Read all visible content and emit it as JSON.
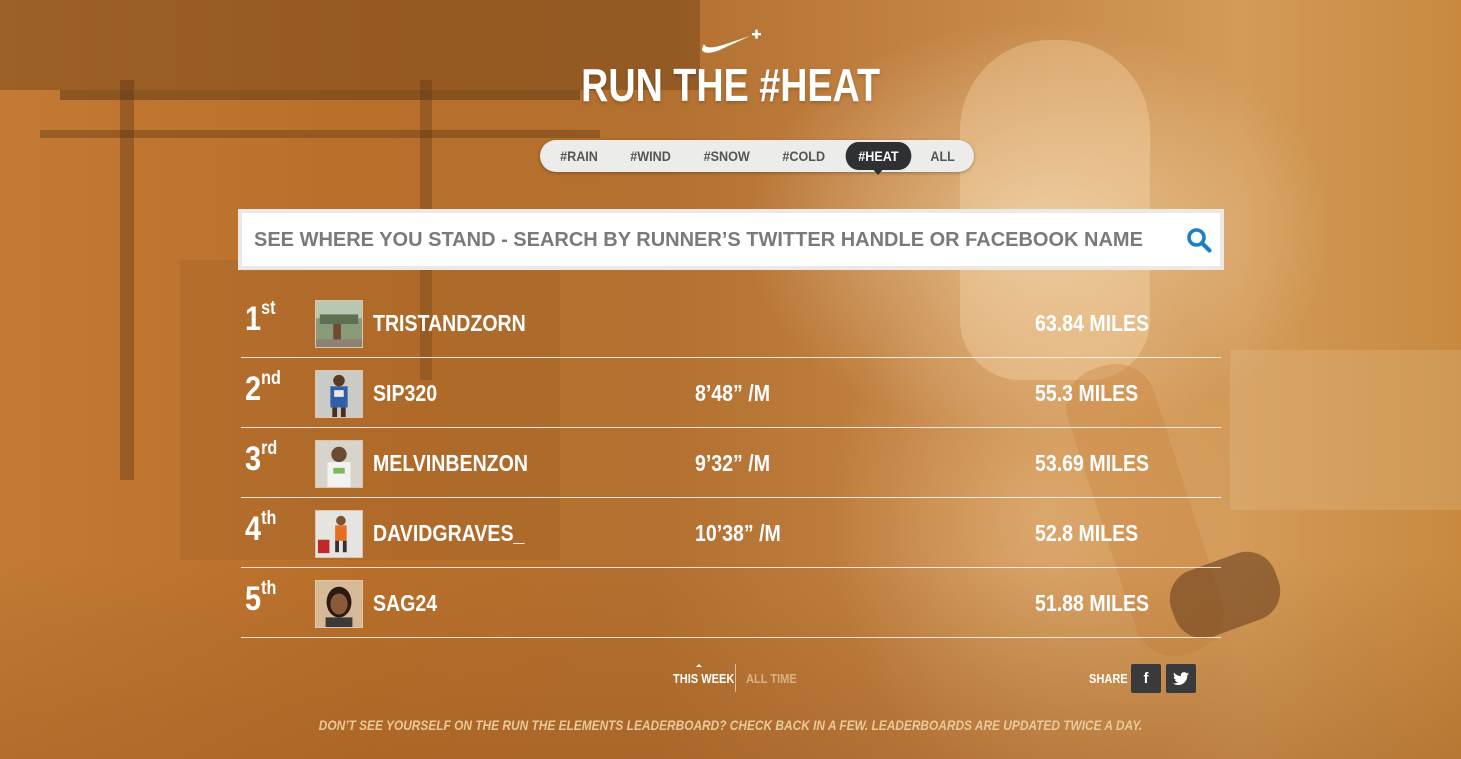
{
  "header": {
    "logo_icon": "nike-plus-swoosh-icon",
    "title": "RUN THE #HEAT"
  },
  "tabs": [
    {
      "label": "#RAIN",
      "active": false
    },
    {
      "label": "#WIND",
      "active": false
    },
    {
      "label": "#SNOW",
      "active": false
    },
    {
      "label": "#COLD",
      "active": false
    },
    {
      "label": "#HEAT",
      "active": true
    },
    {
      "label": "ALL",
      "active": false
    }
  ],
  "search": {
    "placeholder": "SEE WHERE YOU STAND - SEARCH BY RUNNER’S TWITTER HANDLE OR FACEBOOK NAME",
    "icon": "search-icon"
  },
  "leaderboard": [
    {
      "rank": "1",
      "suffix": "st",
      "name": "TRISTANDZORN",
      "pace": "",
      "miles": "63.84 MILES"
    },
    {
      "rank": "2",
      "suffix": "nd",
      "name": "SIP320",
      "pace": "8’48” /M",
      "miles": "55.3 MILES"
    },
    {
      "rank": "3",
      "suffix": "rd",
      "name": "MELVINBENZON",
      "pace": "9’32” /M",
      "miles": "53.69 MILES"
    },
    {
      "rank": "4",
      "suffix": "th",
      "name": "DAVIDGRAVES_",
      "pace": "10’38” /M",
      "miles": "52.8 MILES"
    },
    {
      "rank": "5",
      "suffix": "th",
      "name": "SAG24",
      "pace": "",
      "miles": "51.88 MILES"
    }
  ],
  "period": {
    "this_week": "THIS WEEK",
    "all_time": "ALL TIME",
    "selected": "this_week"
  },
  "share": {
    "label": "SHARE",
    "facebook": "f",
    "twitter_icon": "twitter-bird-icon"
  },
  "footer": {
    "note": "DON’T SEE YOURSELF ON THE RUN THE ELEMENTS LEADERBOARD? CHECK BACK IN A FEW. LEADERBOARDS ARE UPDATED TWICE A DAY."
  },
  "colors": {
    "background": "#c27a34",
    "tab_active": "#2f3033",
    "tab_bar": "#ececea",
    "search_icon": "#1a7fc7",
    "social_button": "#3a3a3c",
    "all_time_inactive": "#d9b37f"
  }
}
